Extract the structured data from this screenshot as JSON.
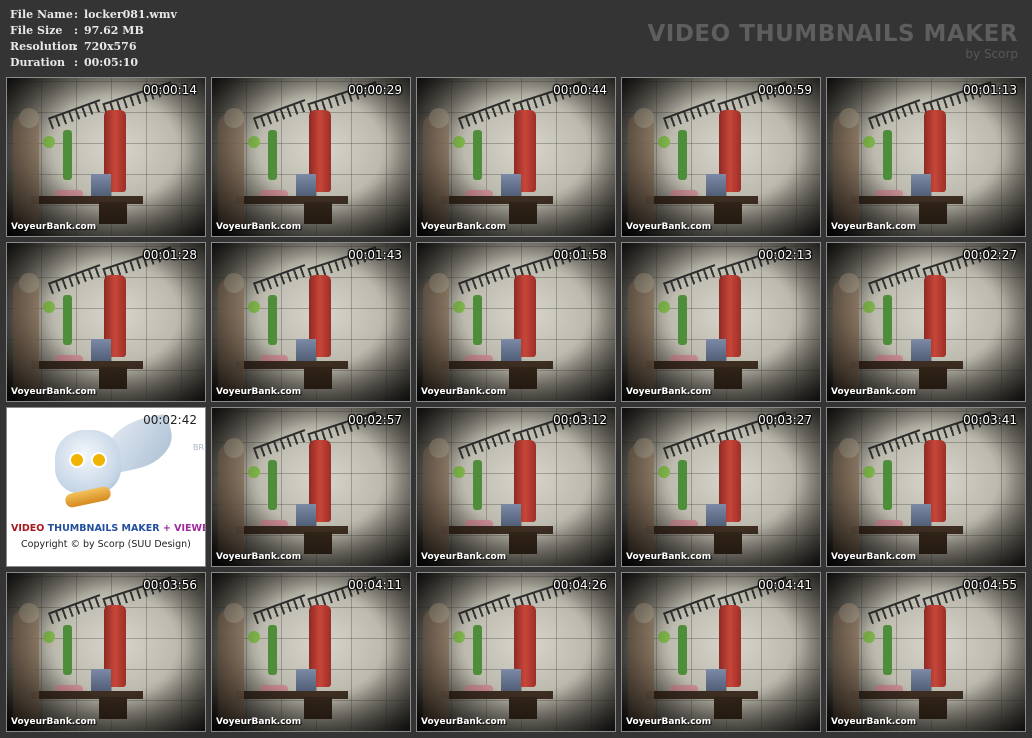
{
  "info": {
    "rows": [
      {
        "key": "File Name",
        "sep": ":",
        "value": "locker081.wmv"
      },
      {
        "key": "File Size",
        "sep": ":",
        "value": "97.62 MB"
      },
      {
        "key": "Resolution",
        "sep": ":",
        "value": "720x576"
      },
      {
        "key": "Duration",
        "sep": ":",
        "value": "00:05:10"
      }
    ]
  },
  "brand": {
    "title": "VIDEO THUMBNAILS MAKER",
    "subtitle": "by Scorp"
  },
  "watermark": "VoyeurBank.com",
  "logo_frame": {
    "title_a": "VIDEO ",
    "title_b": "THUMBNAILS MAKER ",
    "title_c": "+ VIEWER",
    "copyright": "Copyright © by Scorp (SUU Design)",
    "side_text": "BR"
  },
  "thumbnails": [
    {
      "time": "00:00:14",
      "type": "frame"
    },
    {
      "time": "00:00:29",
      "type": "frame"
    },
    {
      "time": "00:00:44",
      "type": "frame"
    },
    {
      "time": "00:00:59",
      "type": "frame"
    },
    {
      "time": "00:01:13",
      "type": "frame"
    },
    {
      "time": "00:01:28",
      "type": "frame"
    },
    {
      "time": "00:01:43",
      "type": "frame"
    },
    {
      "time": "00:01:58",
      "type": "frame"
    },
    {
      "time": "00:02:13",
      "type": "frame"
    },
    {
      "time": "00:02:27",
      "type": "frame"
    },
    {
      "time": "00:02:42",
      "type": "logo"
    },
    {
      "time": "00:02:57",
      "type": "frame"
    },
    {
      "time": "00:03:12",
      "type": "frame"
    },
    {
      "time": "00:03:27",
      "type": "frame"
    },
    {
      "time": "00:03:41",
      "type": "frame"
    },
    {
      "time": "00:03:56",
      "type": "frame"
    },
    {
      "time": "00:04:11",
      "type": "frame"
    },
    {
      "time": "00:04:26",
      "type": "frame"
    },
    {
      "time": "00:04:41",
      "type": "frame"
    },
    {
      "time": "00:04:55",
      "type": "frame"
    }
  ]
}
